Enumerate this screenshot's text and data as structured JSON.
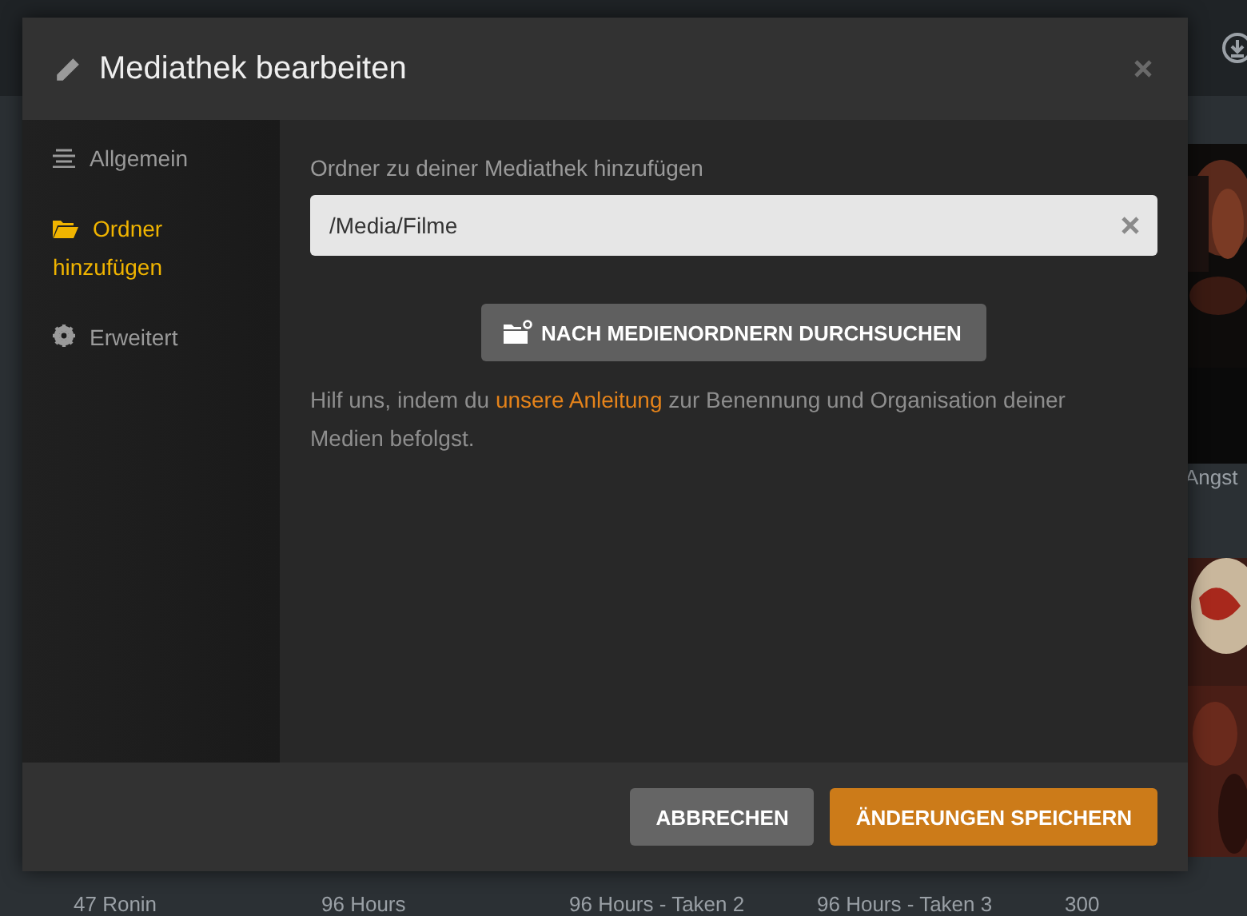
{
  "background": {
    "side_titles": [
      "Angst"
    ],
    "poster_titles": [
      "47 Ronin",
      "96 Hours",
      "96 Hours - Taken 2",
      "96 Hours - Taken 3",
      "300"
    ]
  },
  "dialog": {
    "title": "Mediathek bearbeiten",
    "nav": [
      {
        "label": "Allgemein",
        "kind": "list",
        "selected": false
      },
      {
        "label": "Ordner hinzufügen",
        "kind": "folder",
        "selected": true
      },
      {
        "label": "Erweitert",
        "kind": "gear",
        "selected": false
      }
    ],
    "folder_label": "Ordner zu deiner Mediathek hinzufügen",
    "folder_value": "/Media/Filme",
    "browse_button": "NACH MEDIENORDNERN DURCHSUCHEN",
    "help": {
      "before": "Hilf uns, indem du ",
      "link": "unsere Anleitung",
      "after": " zur Benennung und Organisation deiner Medien befolgst."
    },
    "buttons": [
      {
        "label": "ABBRECHEN",
        "kind": "secondary"
      },
      {
        "label": "ÄNDERUNGEN SPEICHERN",
        "kind": "primary"
      }
    ]
  }
}
